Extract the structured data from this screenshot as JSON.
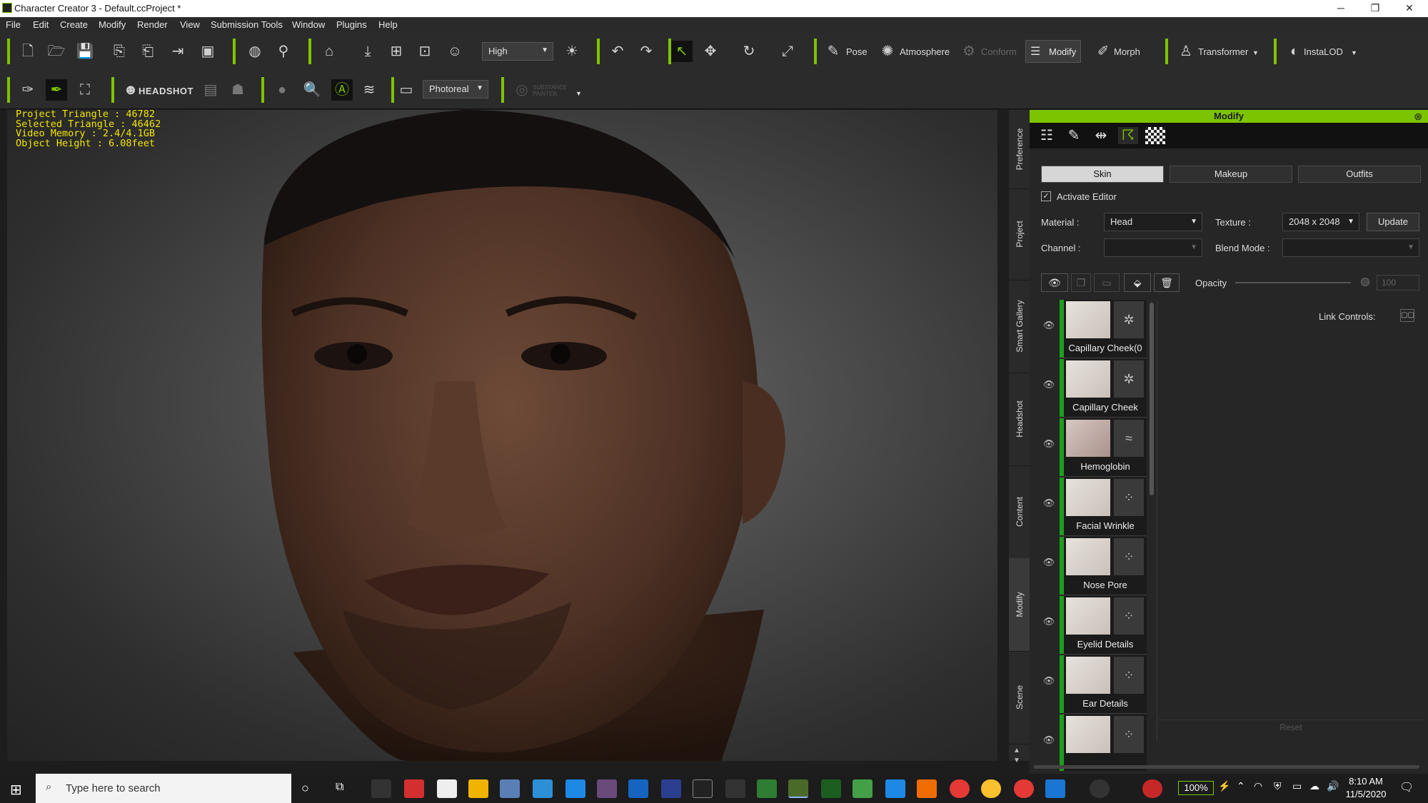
{
  "window": {
    "title": "Character Creator 3 - Default.ccProject *",
    "minimize": "─",
    "restore": "❐",
    "close": "✕"
  },
  "menu": [
    "File",
    "Edit",
    "Create",
    "Modify",
    "Render",
    "View",
    "Submission Tools",
    "Window",
    "Plugins",
    "Help"
  ],
  "toolbar1": {
    "quality_value": "High",
    "pose_label": "Pose",
    "atmosphere_label": "Atmosphere",
    "conform_label": "Conform",
    "modify_label": "Modify",
    "morph_label": "Morph",
    "transformer_label": "Transformer",
    "instalod_label": "InstaLOD"
  },
  "toolbar2": {
    "headshot_label": "HEADSHOT",
    "render_mode_value": "Photoreal",
    "substance_label": "SUBSTANCE PAINTER"
  },
  "viewport": {
    "stats": "Project Triangle : 46782\nSelected Triangle : 46462\nVideo Memory : 2.4/4.1GB\nObject Height : 6.08feet"
  },
  "side_tabs": [
    "Preference",
    "Project",
    "Smart Gallery",
    "Headshot",
    "Content",
    "Modify",
    "Scene"
  ],
  "panel": {
    "title": "Modify",
    "tabs": [
      "Skin",
      "Makeup",
      "Outfits"
    ],
    "activate_editor": "Activate Editor",
    "material_label": "Material :",
    "material_value": "Head",
    "texture_label": "Texture :",
    "texture_value": "2048 x 2048",
    "update_label": "Update",
    "channel_label": "Channel :",
    "channel_value": "",
    "blend_mode_label": "Blend Mode :",
    "blend_mode_value": "",
    "opacity_label": "Opacity",
    "opacity_value": "100",
    "link_controls_label": "Link Controls:",
    "reset_label": "Reset",
    "layers": [
      "Capillary Cheek(0",
      "Capillary Cheek",
      "Hemoglobin",
      "Facial Wrinkle",
      "Nose Pore",
      "Eyelid Details",
      "Ear Details",
      ""
    ]
  },
  "taskbar": {
    "search_placeholder": "Type here to search",
    "battery": "100%",
    "time": "8:10 AM",
    "date": "11/5/2020"
  },
  "colors": {
    "accent": "#7dc400",
    "stats_text": "#f2e500",
    "layer_bar": "#1e9e1e"
  }
}
